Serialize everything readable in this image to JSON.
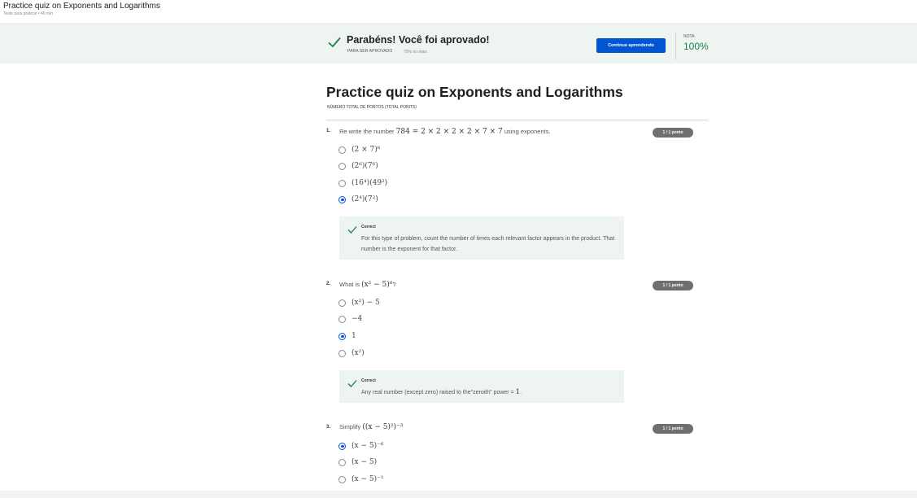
{
  "header": {
    "title": "Practice quiz on Exponents and Logarithms",
    "subtitle": "Teste para praticar • 40 min"
  },
  "banner": {
    "congrats": "Parabéns! Você foi aprovado!",
    "pass_label": "PARA SER APROVADO",
    "pass_value": "75% ou mais",
    "continue_label": "Continue aprendendo",
    "grade_label": "NOTA",
    "grade_value": "100%",
    "accent_color": "#0056d2",
    "success_color": "#1c7c54"
  },
  "quiz": {
    "title": "Practice quiz on Exponents and Logarithms",
    "total_points_label": "NÚMERO TOTAL DE PONTOS (TOTAL POINTS)"
  },
  "questions": [
    {
      "number": "1.",
      "prompt_pre": "Re write the number ",
      "prompt_math": "784 = 2 × 2 × 2 × 2 × 7 × 7",
      "prompt_post": " using exponents.",
      "points": "1 / 1 ponto",
      "options": [
        "(2 × 7)⁶",
        "(2⁶)(7⁶)",
        "(16⁴)(49²)",
        "(2⁴)(7²)"
      ],
      "selected_index": 3,
      "feedback_label": "Correct",
      "feedback_pre": "For this type of problem, count the number of times each relevant factor appears in the product. That number is the exponent for that factor.",
      "feedback_math": "",
      "feedback_post": ""
    },
    {
      "number": "2.",
      "prompt_pre": "What is ",
      "prompt_math": "(x² − 5)⁰",
      "prompt_post": "?",
      "points": "1 / 1 ponto",
      "options": [
        "(x²) − 5",
        "−4",
        "1",
        "(x²)"
      ],
      "selected_index": 2,
      "feedback_label": "Correct",
      "feedback_pre": "Any real number (except zero) raised to the\"zeroith\" power = ",
      "feedback_math": "1",
      "feedback_post": "."
    },
    {
      "number": "3.",
      "prompt_pre": "Simplify ",
      "prompt_math": "((x − 5)²)⁻³",
      "prompt_post": "",
      "points": "1 / 1 ponto",
      "options": [
        "(x − 5)⁻⁶",
        "(x − 5)",
        "(x − 5)⁻¹"
      ],
      "selected_index": 0
    }
  ]
}
